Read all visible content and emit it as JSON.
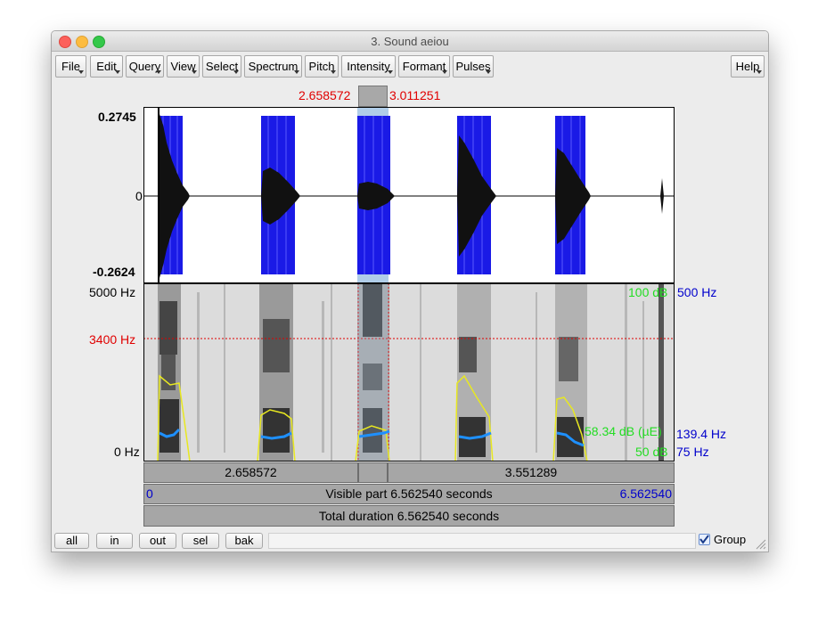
{
  "window": {
    "title": "3. Sound aeiou"
  },
  "menu": {
    "file": "File",
    "edit": "Edit",
    "query": "Query",
    "view": "View",
    "select": "Select",
    "spectrum": "Spectrum",
    "pitch": "Pitch",
    "intensity": "Intensity",
    "formant": "Formant",
    "pulses": "Pulses",
    "help": "Help"
  },
  "selection": {
    "start": "2.658572",
    "end": "3.011251"
  },
  "waveform": {
    "y_max": "0.2745",
    "y_zero": "0",
    "y_min": "-0.2624"
  },
  "spectrogram": {
    "freq_max": "5000 Hz",
    "freq_cursor": "3400 Hz",
    "freq_min": "0 Hz",
    "intensity_max": "100 dB",
    "intensity_value": "58.34 dB (µE)",
    "intensity_min": "50 dB",
    "pitch_max": "500 Hz",
    "pitch_value": "139.4 Hz",
    "pitch_min": "75 Hz"
  },
  "time_bars": {
    "left_segment": "2.658572",
    "right_segment": "3.551289",
    "visible_start": "0",
    "visible_label": "Visible part 6.562540 seconds",
    "visible_end": "6.562540",
    "total_label": "Total duration 6.562540 seconds"
  },
  "bottom": {
    "all": "all",
    "in": "in",
    "out": "out",
    "sel": "sel",
    "bak": "bak",
    "group": "Group"
  },
  "colors": {
    "selection_red": "#e00000",
    "pulse_blue": "#1a1ae6",
    "pitch_blue": "#0000cc",
    "intensity_green": "#22dd22",
    "pitch_curve": "#1e90ff",
    "intensity_curve": "#e8e820"
  }
}
